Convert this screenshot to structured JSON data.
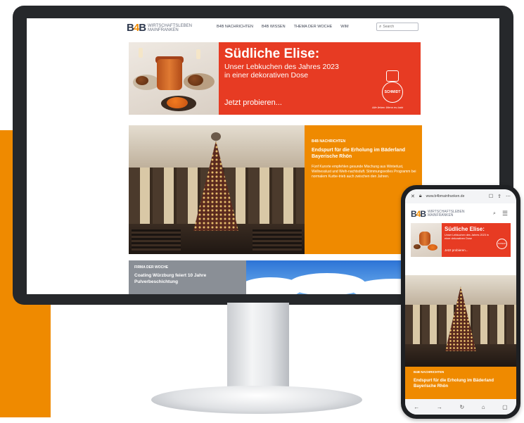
{
  "site": {
    "logo_mark_b1": "B",
    "logo_mark_four": "4",
    "logo_mark_b2": "B",
    "logo_line1": "Wirtschaftsleben",
    "logo_line2": "Mainfranken"
  },
  "desktop": {
    "nav": [
      "B4B NACHRICHTEN",
      "B4B WISSEN",
      "THEMA DER WOCHE",
      "WIM"
    ],
    "search_placeholder": "Search",
    "ad": {
      "title": "Südliche Elise:",
      "subtitle": "Unser Lebkuchen des Jahres 2023 in einer dekorativen Dose",
      "cta": "Jetzt probieren...",
      "brand": "SCHMIDT",
      "slogan": "Alle lieben Wenn es bakt"
    },
    "hero": {
      "kicker": "B4B NACHRICHTEN",
      "title": "Endspurt für die Erholung im Bäderland Bayerische Rhön",
      "text": "Fünf Kurorte empfehlen gesunde Mischung aus Winterlust, Wellnesslust und Weih-nachtsduft. Stimmungsvolles Programm bei normalem Kurbe-trieb auch zwischen den Jahren."
    },
    "firma": {
      "kicker": "FIRMA DER WOCHE",
      "title": "Coating Würzburg feiert 10 Jahre Pulverbeschichtung"
    }
  },
  "phone": {
    "url": "www.b4bmainfranken.de",
    "ad": {
      "title": "Südliche Elise:",
      "subtitle": "Unser Lebkuchen des Jahres 2023 in einer dekorativen Dose",
      "cta": "Jetzt probieren...",
      "brand": "SCHMIDT"
    },
    "hero": {
      "kicker": "B4B NACHRICHTEN",
      "title": "Endspurt für die Erholung im Bäderland Bayerische Rhön"
    }
  },
  "colors": {
    "accent_orange": "#ef8a00",
    "ad_red": "#e73b23",
    "logo_navy": "#2f3a4f"
  }
}
